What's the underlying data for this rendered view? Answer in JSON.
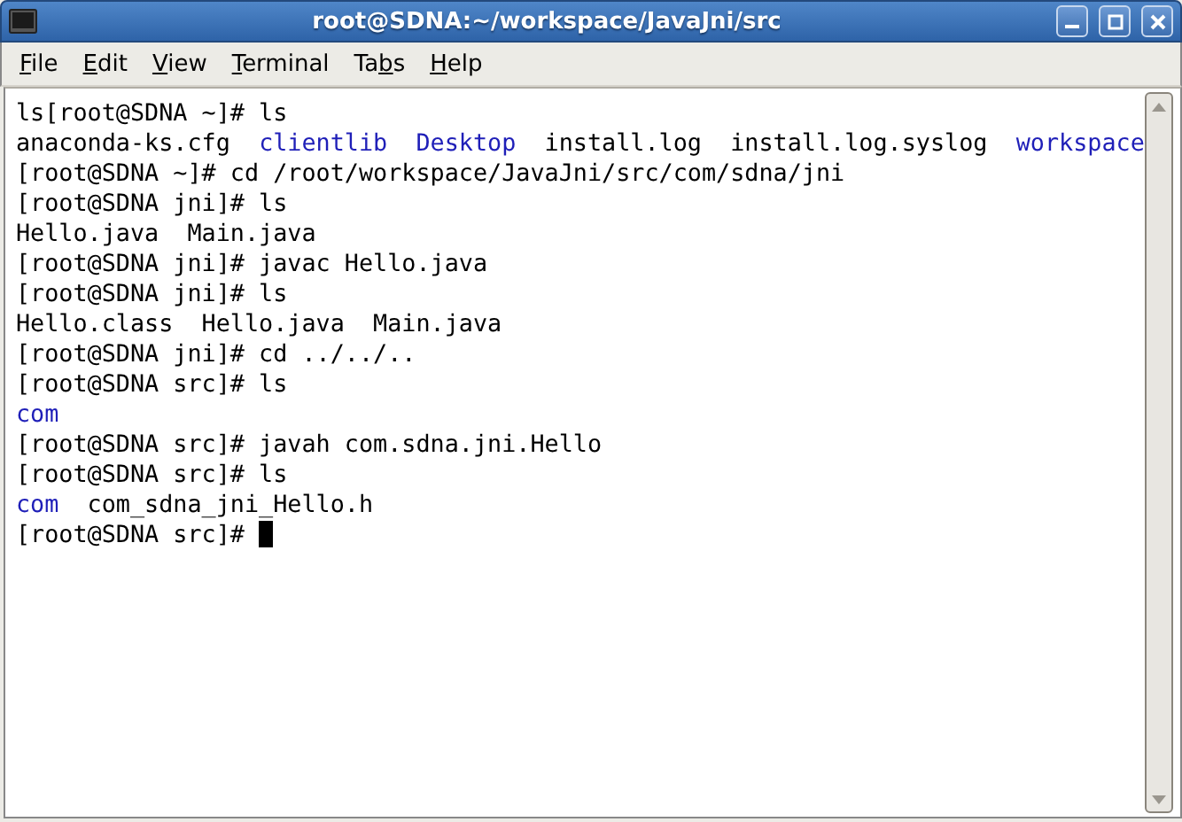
{
  "window": {
    "title": "root@SDNA:~/workspace/JavaJni/src"
  },
  "menu": [
    {
      "key": "F",
      "suffix": "ile"
    },
    {
      "key": "E",
      "suffix": "dit"
    },
    {
      "key": "V",
      "suffix": "iew"
    },
    {
      "key": "T",
      "suffix": "erminal"
    },
    {
      "prefix": "Ta",
      "key": "b",
      "suffix": "s"
    },
    {
      "key": "H",
      "suffix": "elp"
    }
  ],
  "terminal": {
    "lines": [
      [
        {
          "kind": "text",
          "text": "ls[root@SDNA ~]# ls"
        }
      ],
      [
        {
          "kind": "text",
          "text": "anaconda-ks.cfg  "
        },
        {
          "kind": "dir",
          "text": "clientlib  "
        },
        {
          "kind": "dir",
          "text": "Desktop"
        },
        {
          "kind": "text",
          "text": "  install.log  install.log.syslog  "
        },
        {
          "kind": "dir",
          "text": "workspace"
        }
      ],
      [
        {
          "kind": "text",
          "text": "[root@SDNA ~]# cd /root/workspace/JavaJni/src/com/sdna/jni"
        }
      ],
      [
        {
          "kind": "text",
          "text": "[root@SDNA jni]# ls"
        }
      ],
      [
        {
          "kind": "text",
          "text": "Hello.java  Main.java"
        }
      ],
      [
        {
          "kind": "text",
          "text": "[root@SDNA jni]# javac Hello.java"
        }
      ],
      [
        {
          "kind": "text",
          "text": "[root@SDNA jni]# ls"
        }
      ],
      [
        {
          "kind": "text",
          "text": "Hello.class  Hello.java  Main.java"
        }
      ],
      [
        {
          "kind": "text",
          "text": "[root@SDNA jni]# cd ../../.."
        }
      ],
      [
        {
          "kind": "text",
          "text": "[root@SDNA src]# ls"
        }
      ],
      [
        {
          "kind": "dir",
          "text": "com"
        }
      ],
      [
        {
          "kind": "text",
          "text": "[root@SDNA src]# javah com.sdna.jni.Hello"
        }
      ],
      [
        {
          "kind": "text",
          "text": "[root@SDNA src]# ls"
        }
      ],
      [
        {
          "kind": "dir",
          "text": "com"
        },
        {
          "kind": "text",
          "text": "  com_sdna_jni_Hello.h"
        }
      ],
      [
        {
          "kind": "text",
          "text": "[root@SDNA src]# "
        },
        {
          "kind": "cursor"
        }
      ]
    ]
  }
}
